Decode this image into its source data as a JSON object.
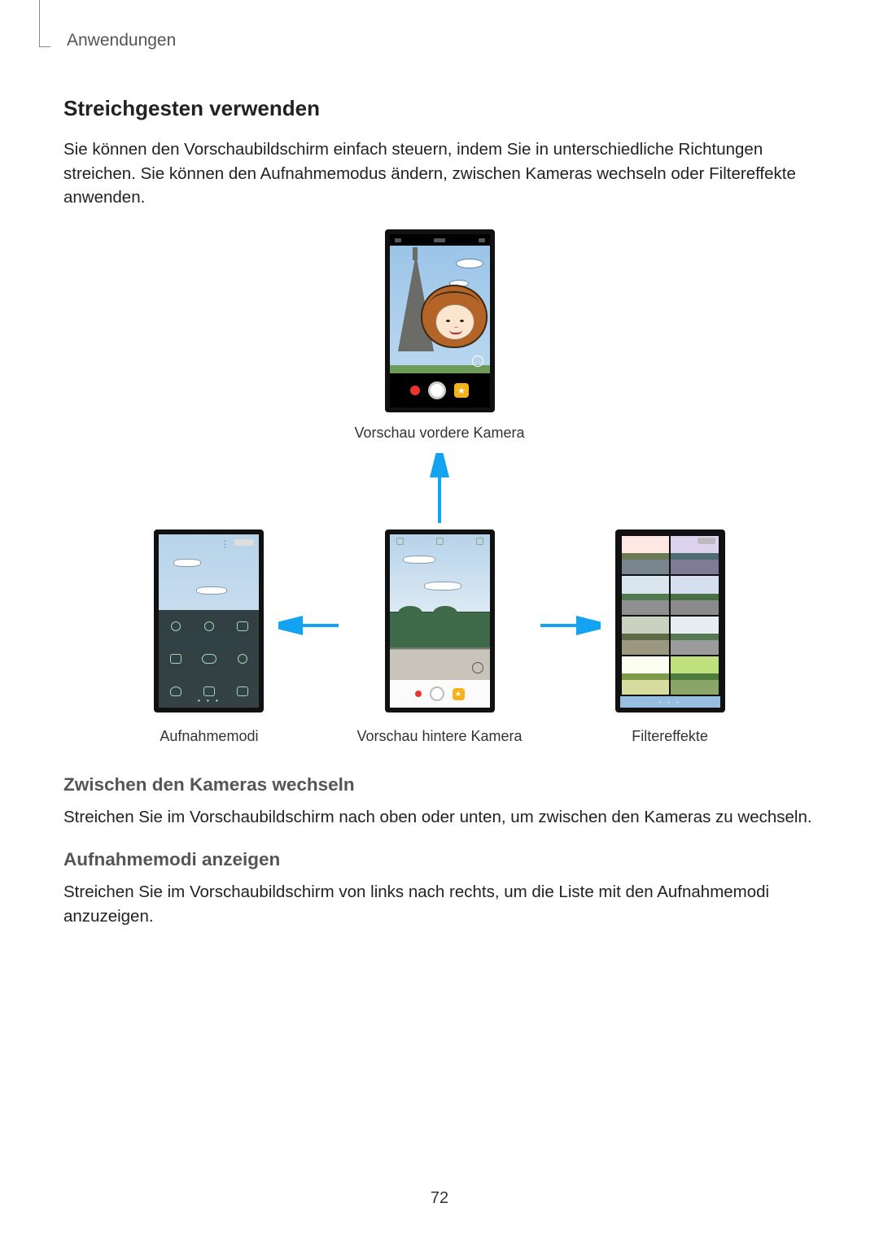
{
  "header": {
    "breadcrumb": "Anwendungen"
  },
  "section": {
    "title": "Streichgesten verwenden",
    "intro": "Sie können den Vorschaubildschirm einfach steuern, indem Sie in unterschiedliche Richtungen streichen. Sie können den Aufnahmemodus ändern, zwischen Kameras wechseln oder Filtereffekte anwenden."
  },
  "figures": {
    "top_caption": "Vorschau vordere Kamera",
    "left_caption": "Aufnahmemodi",
    "center_caption": "Vorschau hintere Kamera",
    "right_caption": "Filtereffekte"
  },
  "subsections": {
    "switch_cam": {
      "title": "Zwischen den Kameras wechseln",
      "body": "Streichen Sie im Vorschaubildschirm nach oben oder unten, um zwischen den Kameras zu wechseln."
    },
    "show_modes": {
      "title": "Aufnahmemodi anzeigen",
      "body": "Streichen Sie im Vorschaubildschirm von links nach rechts, um die Liste mit den Aufnahmemodi anzuzeigen."
    }
  },
  "page_number": "72",
  "colors": {
    "arrow": "#13a3f0"
  }
}
